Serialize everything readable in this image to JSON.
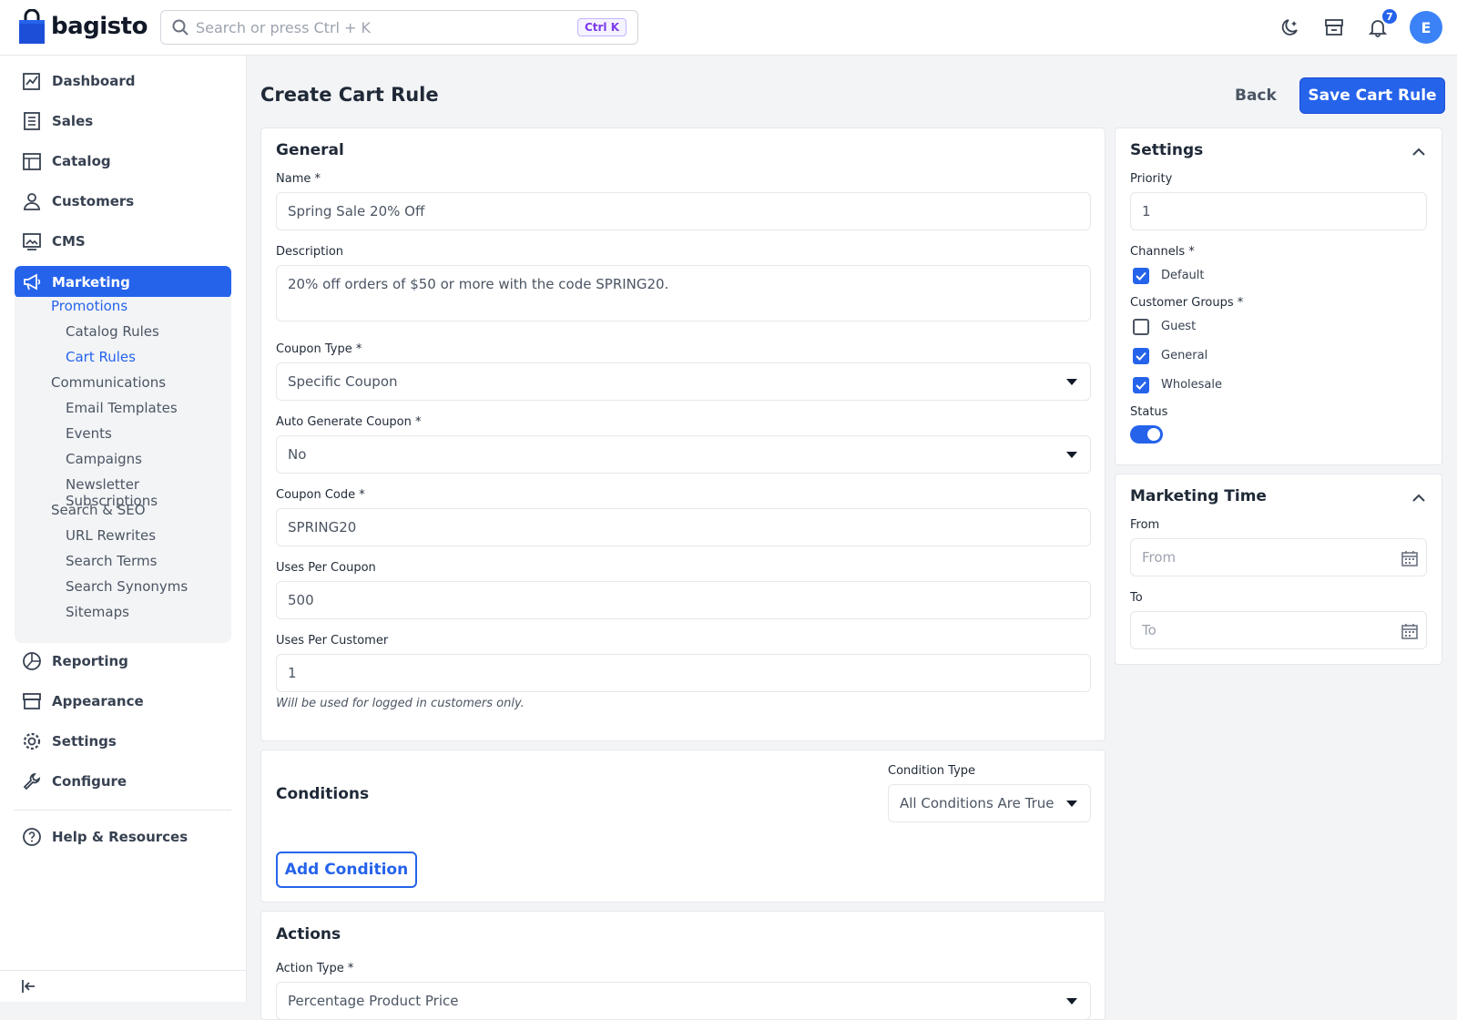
{
  "app": {
    "logo_text": "bagisto"
  },
  "search": {
    "placeholder": "Search or press Ctrl + K",
    "shortcut": "Ctrl K"
  },
  "notifications": {
    "count": "7"
  },
  "user": {
    "initial": "E"
  },
  "sidebar": {
    "items": [
      {
        "label": "Dashboard",
        "icon": "dashboard-icon"
      },
      {
        "label": "Sales",
        "icon": "sales-icon"
      },
      {
        "label": "Catalog",
        "icon": "catalog-icon"
      },
      {
        "label": "Customers",
        "icon": "customers-icon"
      },
      {
        "label": "CMS",
        "icon": "cms-icon"
      },
      {
        "label": "Marketing",
        "icon": "marketing-icon"
      },
      {
        "label": "Reporting",
        "icon": "reporting-icon"
      },
      {
        "label": "Appearance",
        "icon": "appearance-icon"
      },
      {
        "label": "Settings",
        "icon": "settings-icon"
      },
      {
        "label": "Configure",
        "icon": "configure-icon"
      },
      {
        "label": "Help & Resources",
        "icon": "help-icon"
      }
    ],
    "submenu": {
      "promotions": "Promotions",
      "catalog_rules": "Catalog Rules",
      "cart_rules": "Cart Rules",
      "communications": "Communications",
      "email_templates": "Email Templates",
      "events": "Events",
      "campaigns": "Campaigns",
      "newsletter": "Newsletter Subscriptions",
      "search_seo": "Search & SEO",
      "url_rewrites": "URL Rewrites",
      "search_terms": "Search Terms",
      "search_synonyms": "Search Synonyms",
      "sitemaps": "Sitemaps"
    }
  },
  "page": {
    "title": "Create Cart Rule",
    "back": "Back",
    "save": "Save Cart Rule"
  },
  "general": {
    "title": "General",
    "name_label": "Name *",
    "name_value": "Spring Sale 20% Off",
    "description_label": "Description",
    "description_value": "20% off orders of $50 or more with the code SPRING20.",
    "coupon_type_label": "Coupon Type *",
    "coupon_type_value": "Specific Coupon",
    "auto_generate_label": "Auto Generate Coupon *",
    "auto_generate_value": "No",
    "coupon_code_label": "Coupon Code *",
    "coupon_code_value": "SPRING20",
    "uses_per_coupon_label": "Uses Per Coupon",
    "uses_per_coupon_value": "500",
    "uses_per_customer_label": "Uses Per Customer",
    "uses_per_customer_value": "1",
    "uses_per_customer_hint": "Will be used for logged in customers only."
  },
  "conditions": {
    "title": "Conditions",
    "type_label": "Condition Type",
    "type_value": "All Conditions Are True",
    "add_button": "Add Condition"
  },
  "actions": {
    "title": "Actions",
    "type_label": "Action Type *",
    "type_value": "Percentage Product Price"
  },
  "settings": {
    "title": "Settings",
    "priority_label": "Priority",
    "priority_value": "1",
    "channels_label": "Channels *",
    "channels": [
      {
        "label": "Default",
        "checked": true
      }
    ],
    "groups_label": "Customer Groups *",
    "groups": [
      {
        "label": "Guest",
        "checked": false
      },
      {
        "label": "General",
        "checked": true
      },
      {
        "label": "Wholesale",
        "checked": true
      }
    ],
    "status_label": "Status",
    "status_on": true
  },
  "marketing_time": {
    "title": "Marketing Time",
    "from_label": "From",
    "from_placeholder": "From",
    "to_label": "To",
    "to_placeholder": "To"
  },
  "colors": {
    "accent": "#2563eb"
  }
}
